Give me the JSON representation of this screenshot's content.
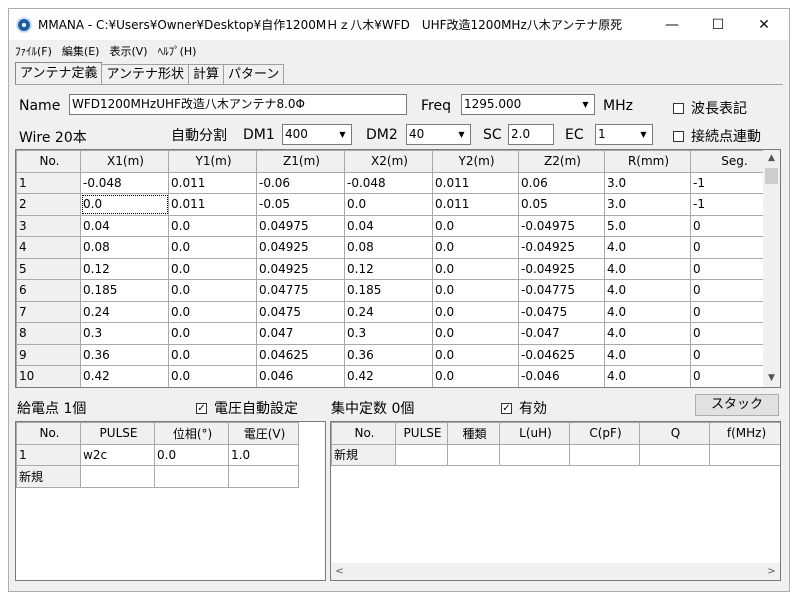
{
  "window": {
    "title": "MMANA - C:¥Users¥Owner¥Desktop¥自作1200MＨｚ八木¥WFD　UHF改造1200MHz八木アンテナ原死",
    "minimize": "—",
    "maximize": "☐",
    "close": "✕"
  },
  "menu": [
    "ﾌｧｲﾙ(F)",
    "編集(E)",
    "表示(V)",
    "ﾍﾙﾌﾟ(H)"
  ],
  "tabs": [
    "アンテナ定義",
    "アンテナ形状",
    "計算",
    "パターン"
  ],
  "definition": {
    "name_label": "Name",
    "name_value": "WFD1200MHzUHF改造八木アンテナ8.0Φ",
    "freq_label": "Freq",
    "freq_value": "1295.000",
    "freq_unit": "MHz",
    "wavelength_label": "波長表記",
    "wavelength_checked": false,
    "wire_label": "Wire 20本",
    "autosplit_label": "自動分割",
    "dm1_label": "DM1",
    "dm1_value": "400",
    "dm2_label": "DM2",
    "dm2_value": "40",
    "sc_label": "SC",
    "sc_value": "2.0",
    "ec_label": "EC",
    "ec_value": "1",
    "connect_label": "接続点連動",
    "connect_checked": false
  },
  "wire_table": {
    "columns": [
      "No.",
      "X1(m)",
      "Y1(m)",
      "Z1(m)",
      "X2(m)",
      "Y2(m)",
      "Z2(m)",
      "R(mm)",
      "Seg."
    ],
    "rows": [
      [
        "1",
        "-0.048",
        "0.011",
        "-0.06",
        "-0.048",
        "0.011",
        "0.06",
        "3.0",
        "-1"
      ],
      [
        "2",
        "0.0",
        "0.011",
        "-0.05",
        "0.0",
        "0.011",
        "0.05",
        "3.0",
        "-1"
      ],
      [
        "3",
        "0.04",
        "0.0",
        "0.04975",
        "0.04",
        "0.0",
        "-0.04975",
        "5.0",
        "0"
      ],
      [
        "4",
        "0.08",
        "0.0",
        "0.04925",
        "0.08",
        "0.0",
        "-0.04925",
        "4.0",
        "0"
      ],
      [
        "5",
        "0.12",
        "0.0",
        "0.04925",
        "0.12",
        "0.0",
        "-0.04925",
        "4.0",
        "0"
      ],
      [
        "6",
        "0.185",
        "0.0",
        "0.04775",
        "0.185",
        "0.0",
        "-0.04775",
        "4.0",
        "0"
      ],
      [
        "7",
        "0.24",
        "0.0",
        "0.0475",
        "0.24",
        "0.0",
        "-0.0475",
        "4.0",
        "0"
      ],
      [
        "8",
        "0.3",
        "0.0",
        "0.047",
        "0.3",
        "0.0",
        "-0.047",
        "4.0",
        "0"
      ],
      [
        "9",
        "0.36",
        "0.0",
        "0.04625",
        "0.36",
        "0.0",
        "-0.04625",
        "4.0",
        "0"
      ],
      [
        "10",
        "0.42",
        "0.0",
        "0.046",
        "0.42",
        "0.0",
        "-0.046",
        "4.0",
        "0"
      ]
    ]
  },
  "feed": {
    "label": "給電点 1個",
    "auto_voltage_label": "電圧自動設定",
    "auto_voltage_checked": true,
    "columns": [
      "No.",
      "PULSE",
      "位相(°)",
      "電圧(V)"
    ],
    "rows": [
      [
        "1",
        "w2c",
        "0.0",
        "1.0"
      ]
    ],
    "new_row": "新規"
  },
  "lumped": {
    "label": "集中定数 0個",
    "enabled_label": "有効",
    "enabled_checked": true,
    "stack_button": "スタック",
    "columns": [
      "No.",
      "PULSE",
      "種類",
      "L(uH)",
      "C(pF)",
      "Q",
      "f(MHz)"
    ],
    "new_row": "新規"
  }
}
